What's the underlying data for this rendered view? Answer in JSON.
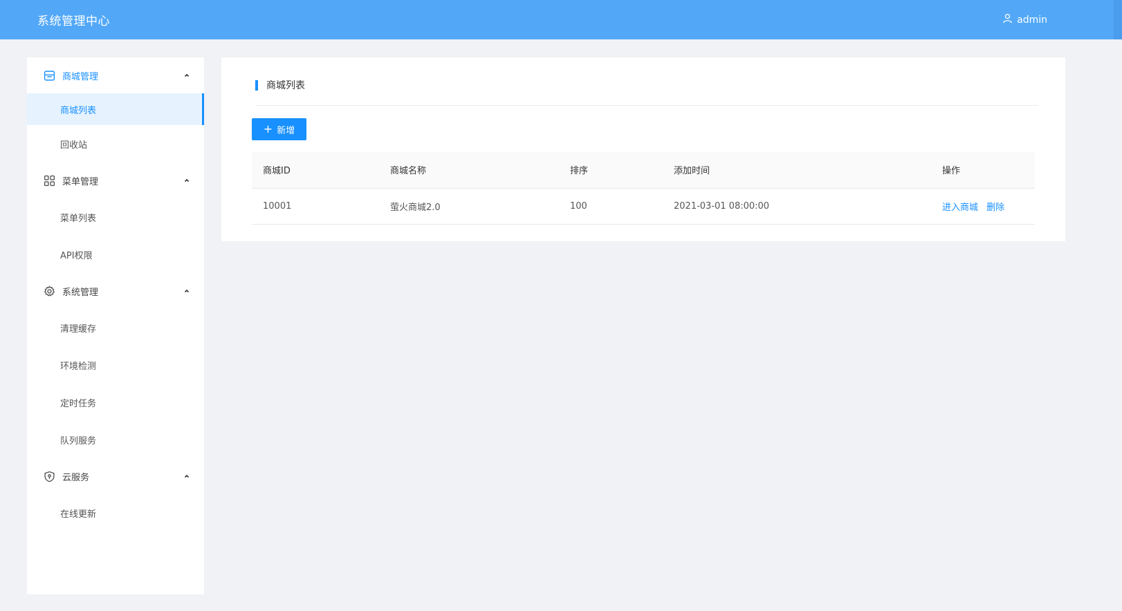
{
  "header": {
    "title": "系统管理中心",
    "user_icon": "user-icon",
    "username": "admin"
  },
  "sidebar": {
    "groups": [
      {
        "label": "商城管理",
        "icon": "store-icon",
        "items": [
          {
            "label": "商城列表",
            "active": true
          },
          {
            "label": "回收站"
          }
        ]
      },
      {
        "label": "菜单管理",
        "icon": "grid-icon",
        "items": [
          {
            "label": "菜单列表"
          },
          {
            "label": "API权限"
          }
        ]
      },
      {
        "label": "系统管理",
        "icon": "gear-icon",
        "items": [
          {
            "label": "清理缓存"
          },
          {
            "label": "环境检测"
          },
          {
            "label": "定时任务"
          },
          {
            "label": "队列服务"
          }
        ]
      },
      {
        "label": "云服务",
        "icon": "shield-icon",
        "items": [
          {
            "label": "在线更新"
          }
        ]
      }
    ]
  },
  "main": {
    "title": "商城列表",
    "add_button": "新增",
    "table": {
      "columns": [
        "商城ID",
        "商城名称",
        "排序",
        "添加时间",
        "操作"
      ],
      "rows": [
        {
          "id": "10001",
          "name": "萤火商城2.0",
          "sort": "100",
          "time": "2021-03-01 08:00:00",
          "actions": [
            "进入商城",
            "删除"
          ]
        }
      ]
    }
  },
  "colors": {
    "header_bg": "#52a8f7",
    "primary": "#1890ff",
    "page_bg": "#f0f2f5",
    "active_item_bg": "#e6f3ff"
  }
}
